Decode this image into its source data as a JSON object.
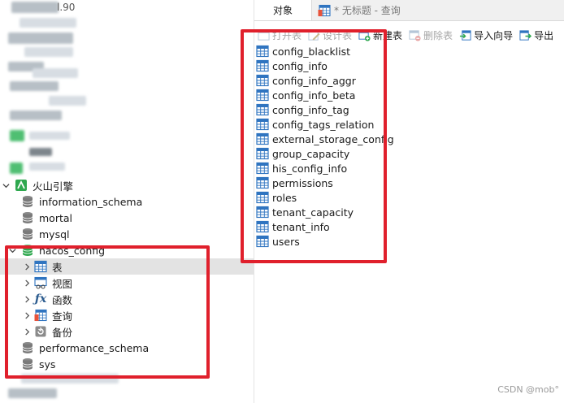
{
  "tabs": {
    "objects": "对象",
    "query": "* 无标题 - 查询"
  },
  "toolbar": {
    "open_table": "打开表",
    "design_table": "设计表",
    "new_table": "新建表",
    "delete_table": "删除表",
    "import_wizard": "导入向导",
    "export_wizard": "导出"
  },
  "sidebar": {
    "connection_name": "火山引擎",
    "databases": [
      "information_schema",
      "mortal",
      "mysql",
      "nacos_config",
      "performance_schema",
      "sys"
    ],
    "nacos_children": [
      "表",
      "视图",
      "函数",
      "查询",
      "备份"
    ],
    "partial_text_top": "l.90"
  },
  "tables": [
    "config_blacklist",
    "config_info",
    "config_info_aggr",
    "config_info_beta",
    "config_info_tag",
    "config_tags_relation",
    "external_storage_config",
    "group_capacity",
    "his_config_info",
    "permissions",
    "roles",
    "tenant_capacity",
    "tenant_info",
    "users"
  ],
  "watermark": "CSDN @mob°",
  "colors": {
    "highlight": "#e0202c",
    "selected_row": "#e3e3e3",
    "table_icon": "#2f74c0",
    "db_icon": "#7a7a7a",
    "active_db_icon": "#2fa84f"
  }
}
